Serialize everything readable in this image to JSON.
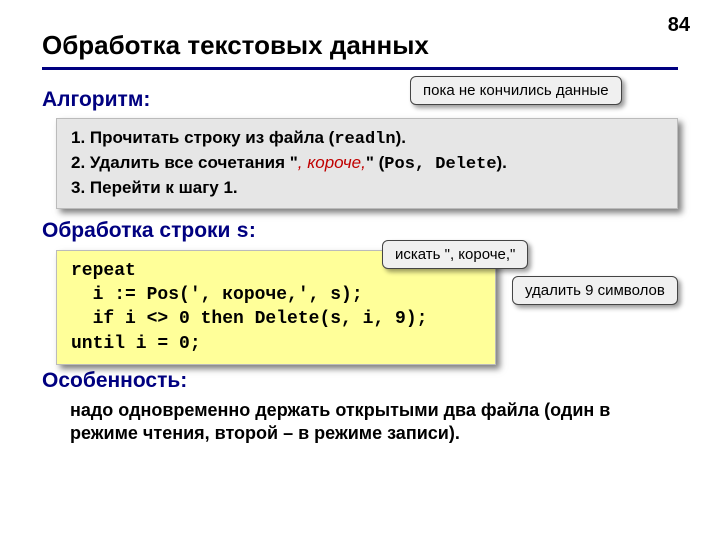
{
  "page_number": "84",
  "title": "Обработка текстовых данных",
  "algorithm": {
    "heading": "Алгоритм:",
    "step1_a": "1. Прочитать строку из файла (",
    "step1_code": "readln",
    "step1_b": ").",
    "step2_a": "2. Удалить все сочетания \"",
    "step2_red": ", короче,",
    "step2_b": "\" (",
    "step2_code": "Pos, Delete",
    "step2_c": ").",
    "step3": "3. Перейти к шагу 1."
  },
  "processing": {
    "heading_a": "Обработка строки ",
    "heading_code": "s",
    "heading_b": ":",
    "code": "repeat\n  i := Pos(', короче,', s);\n  if i <> 0 then Delete(s, i, 9);\nuntil i = 0;"
  },
  "feature": {
    "heading": "Особенность:",
    "text": "надо одновременно держать открытыми два файла (один в режиме чтения, второй – в режиме записи)."
  },
  "callouts": {
    "until_end": "пока не кончились данные",
    "search": "искать \", короче,\"",
    "delete9": "удалить 9 символов"
  }
}
